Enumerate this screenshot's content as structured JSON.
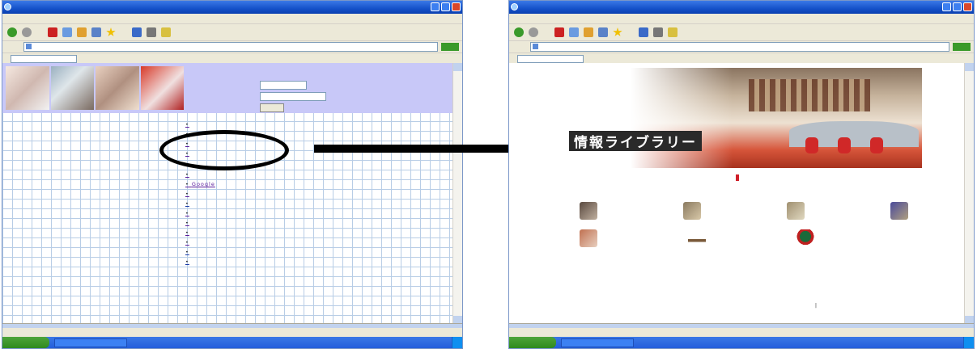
{
  "left_window": {
    "title": "",
    "taskbar": {
      "start_label": "",
      "items": [
        ""
      ],
      "tray_text": ""
    },
    "status_text": "",
    "header_link": "",
    "go_button": "",
    "links": [
      {
        "label": ""
      },
      {
        "label": ""
      },
      {
        "label": ""
      },
      {
        "label": ""
      },
      {
        "label": ""
      },
      {
        "label": "Google"
      },
      {
        "label": ""
      },
      {
        "label": ""
      },
      {
        "label": ""
      },
      {
        "label": ""
      },
      {
        "label": ""
      },
      {
        "label": ""
      },
      {
        "label": ""
      },
      {
        "label": ""
      }
    ]
  },
  "right_window": {
    "title": "",
    "status_text": "",
    "taskbar": {
      "start_label": "",
      "items": [
        ""
      ],
      "tray_text": ""
    },
    "banner_title": "情報ライブラリー",
    "welcome_highlight": "",
    "icons": [
      {
        "link": "",
        "desc": ""
      },
      {
        "link": "",
        "desc": ""
      },
      {
        "link": "",
        "desc": ""
      },
      {
        "link": "",
        "desc": ""
      },
      {
        "link": "",
        "desc": ""
      },
      {
        "link": "",
        "desc": ""
      },
      {
        "link": "",
        "desc": ""
      }
    ],
    "bottom_links": [
      "",
      "",
      ""
    ],
    "copyright": ""
  },
  "colors": {
    "xp_blue": "#245edb",
    "link_purple": "#5a1a9a",
    "highlight_red": "#d0202a",
    "header_lavender": "#c8c8f8"
  }
}
